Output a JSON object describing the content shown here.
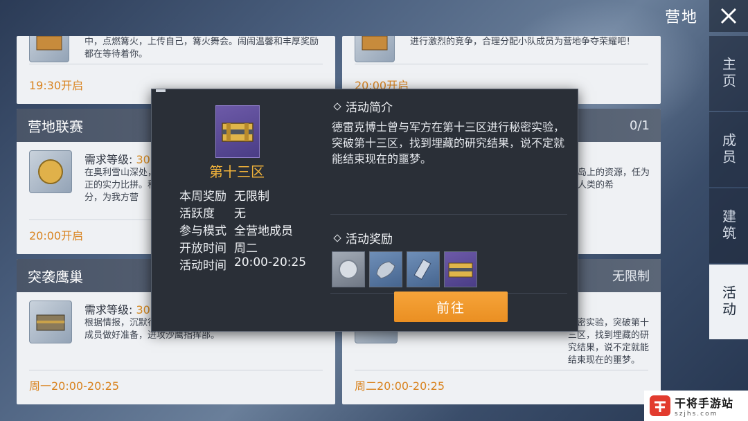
{
  "header": {
    "title": "营地"
  },
  "sidenav": {
    "items": [
      {
        "label": "主页"
      },
      {
        "label": "成员"
      },
      {
        "label": "建筑"
      },
      {
        "label": "活动"
      }
    ]
  },
  "cards": {
    "top_left": {
      "desc": "中，点燃篝火，上传自己，篝火舞会。闹闹温馨和丰厚奖励都在等待着你。",
      "time": "19:30开启"
    },
    "top_right": {
      "desc": "进行激烈的竞争，合理分配小队成员为营地争夺荣耀吧！",
      "time": "20:00开启"
    },
    "mid_left": {
      "title": "营地联赛",
      "req_label": "需求等级: ",
      "req_value": "30",
      "desc": "在奥利雪山深处，正的实力比拼。积分，为我方营",
      "time": "20:00开启"
    },
    "mid_right": {
      "count": "0/1",
      "desc": "岛上的资源，任为人类的希"
    },
    "bot_left": {
      "title": "突袭鹰巢",
      "req_label": "需求等级: ",
      "req_value": "30",
      "desc": "根据情报，沉默行武装集结，准备要挑起事端，请各位营地成员做好准备，进攻沙鹰指挥部。",
      "time": "周一20:00-20:25"
    },
    "bot_right": {
      "badge": "无限制",
      "desc": "秘密实验，突破第十三区，找到埋藏的研究结果，说不定就能结束现在的噩梦。",
      "time": "周二20:00-20:25"
    }
  },
  "modal": {
    "item_name": "第十三区",
    "info": [
      {
        "key": "本周奖励",
        "value": "无限制"
      },
      {
        "key": "活跃度",
        "value": "无"
      },
      {
        "key": "参与模式",
        "value": "全营地成员"
      },
      {
        "key": "开放时间",
        "value": "周二"
      },
      {
        "key": "活动时间",
        "value": "20:00-20:25"
      }
    ],
    "intro_title": "活动简介",
    "intro_text": "德雷克博士曾与军方在第十三区进行秘密实验，突破第十三区，找到埋藏的研究结果，说不定就能结束现在的噩梦。",
    "rewards_title": "活动奖励",
    "rewards": [
      {
        "icon": "coin-icon"
      },
      {
        "icon": "armor-icon"
      },
      {
        "icon": "device-icon"
      },
      {
        "icon": "gold-crate-icon"
      }
    ],
    "go_button": "前往"
  },
  "watermark": {
    "main": "干将手游站",
    "sub": "szjhs.com"
  },
  "colors": {
    "accent_orange": "#f6a43a",
    "item_gold": "#f0b23a",
    "time_orange": "#d9831f"
  }
}
